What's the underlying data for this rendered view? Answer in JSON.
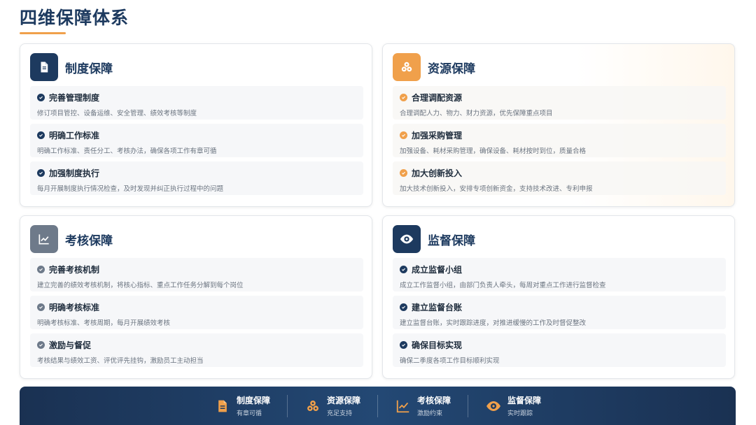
{
  "page": {
    "title": "四维保障体系"
  },
  "accent_color": "#f0a04b",
  "navy_color": "#1d3a5f",
  "cards": [
    {
      "title": "制度保障",
      "icon": "document-icon",
      "items": [
        {
          "title": "完善管理制度",
          "desc": "修订项目管控、设备运维、安全管理、绩效考核等制度"
        },
        {
          "title": "明确工作标准",
          "desc": "明确工作标准、责任分工、考核办法，确保各项工作有章可循"
        },
        {
          "title": "加强制度执行",
          "desc": "每月开展制度执行情况检查，及时发现并纠正执行过程中的问题"
        }
      ]
    },
    {
      "title": "资源保障",
      "icon": "resources-icon",
      "items": [
        {
          "title": "合理调配资源",
          "desc": "合理调配人力、物力、财力资源，优先保障重点项目"
        },
        {
          "title": "加强采购管理",
          "desc": "加强设备、耗材采购管理，确保设备、耗材按时到位，质量合格"
        },
        {
          "title": "加大创新投入",
          "desc": "加大技术创新投入，安排专项创新资金，支持技术改进、专利申报"
        }
      ]
    },
    {
      "title": "考核保障",
      "icon": "chart-line-icon",
      "items": [
        {
          "title": "完善考核机制",
          "desc": "建立完善的绩效考核机制，将核心指标、重点工作任务分解到每个岗位"
        },
        {
          "title": "明确考核标准",
          "desc": "明确考核标准、考核周期，每月开展绩效考核"
        },
        {
          "title": "激励与督促",
          "desc": "考核结果与绩效工资、评优评先挂钩，激励员工主动担当"
        }
      ]
    },
    {
      "title": "监督保障",
      "icon": "eye-icon",
      "items": [
        {
          "title": "成立监督小组",
          "desc": "成立工作监督小组，由部门负责人牵头，每周对重点工作进行监督检查"
        },
        {
          "title": "建立监督台账",
          "desc": "建立监督台账，实时跟踪进度，对推进缓慢的工作及时督促整改"
        },
        {
          "title": "确保目标实现",
          "desc": "确保二季度各项工作目标顺利实现"
        }
      ]
    }
  ],
  "banner": [
    {
      "label": "制度保障",
      "sub": "有章可循",
      "icon": "document-icon"
    },
    {
      "label": "资源保障",
      "sub": "充足支持",
      "icon": "resources-icon"
    },
    {
      "label": "考核保障",
      "sub": "激励约束",
      "icon": "chart-line-icon"
    },
    {
      "label": "监督保障",
      "sub": "实时跟踪",
      "icon": "eye-icon"
    }
  ]
}
